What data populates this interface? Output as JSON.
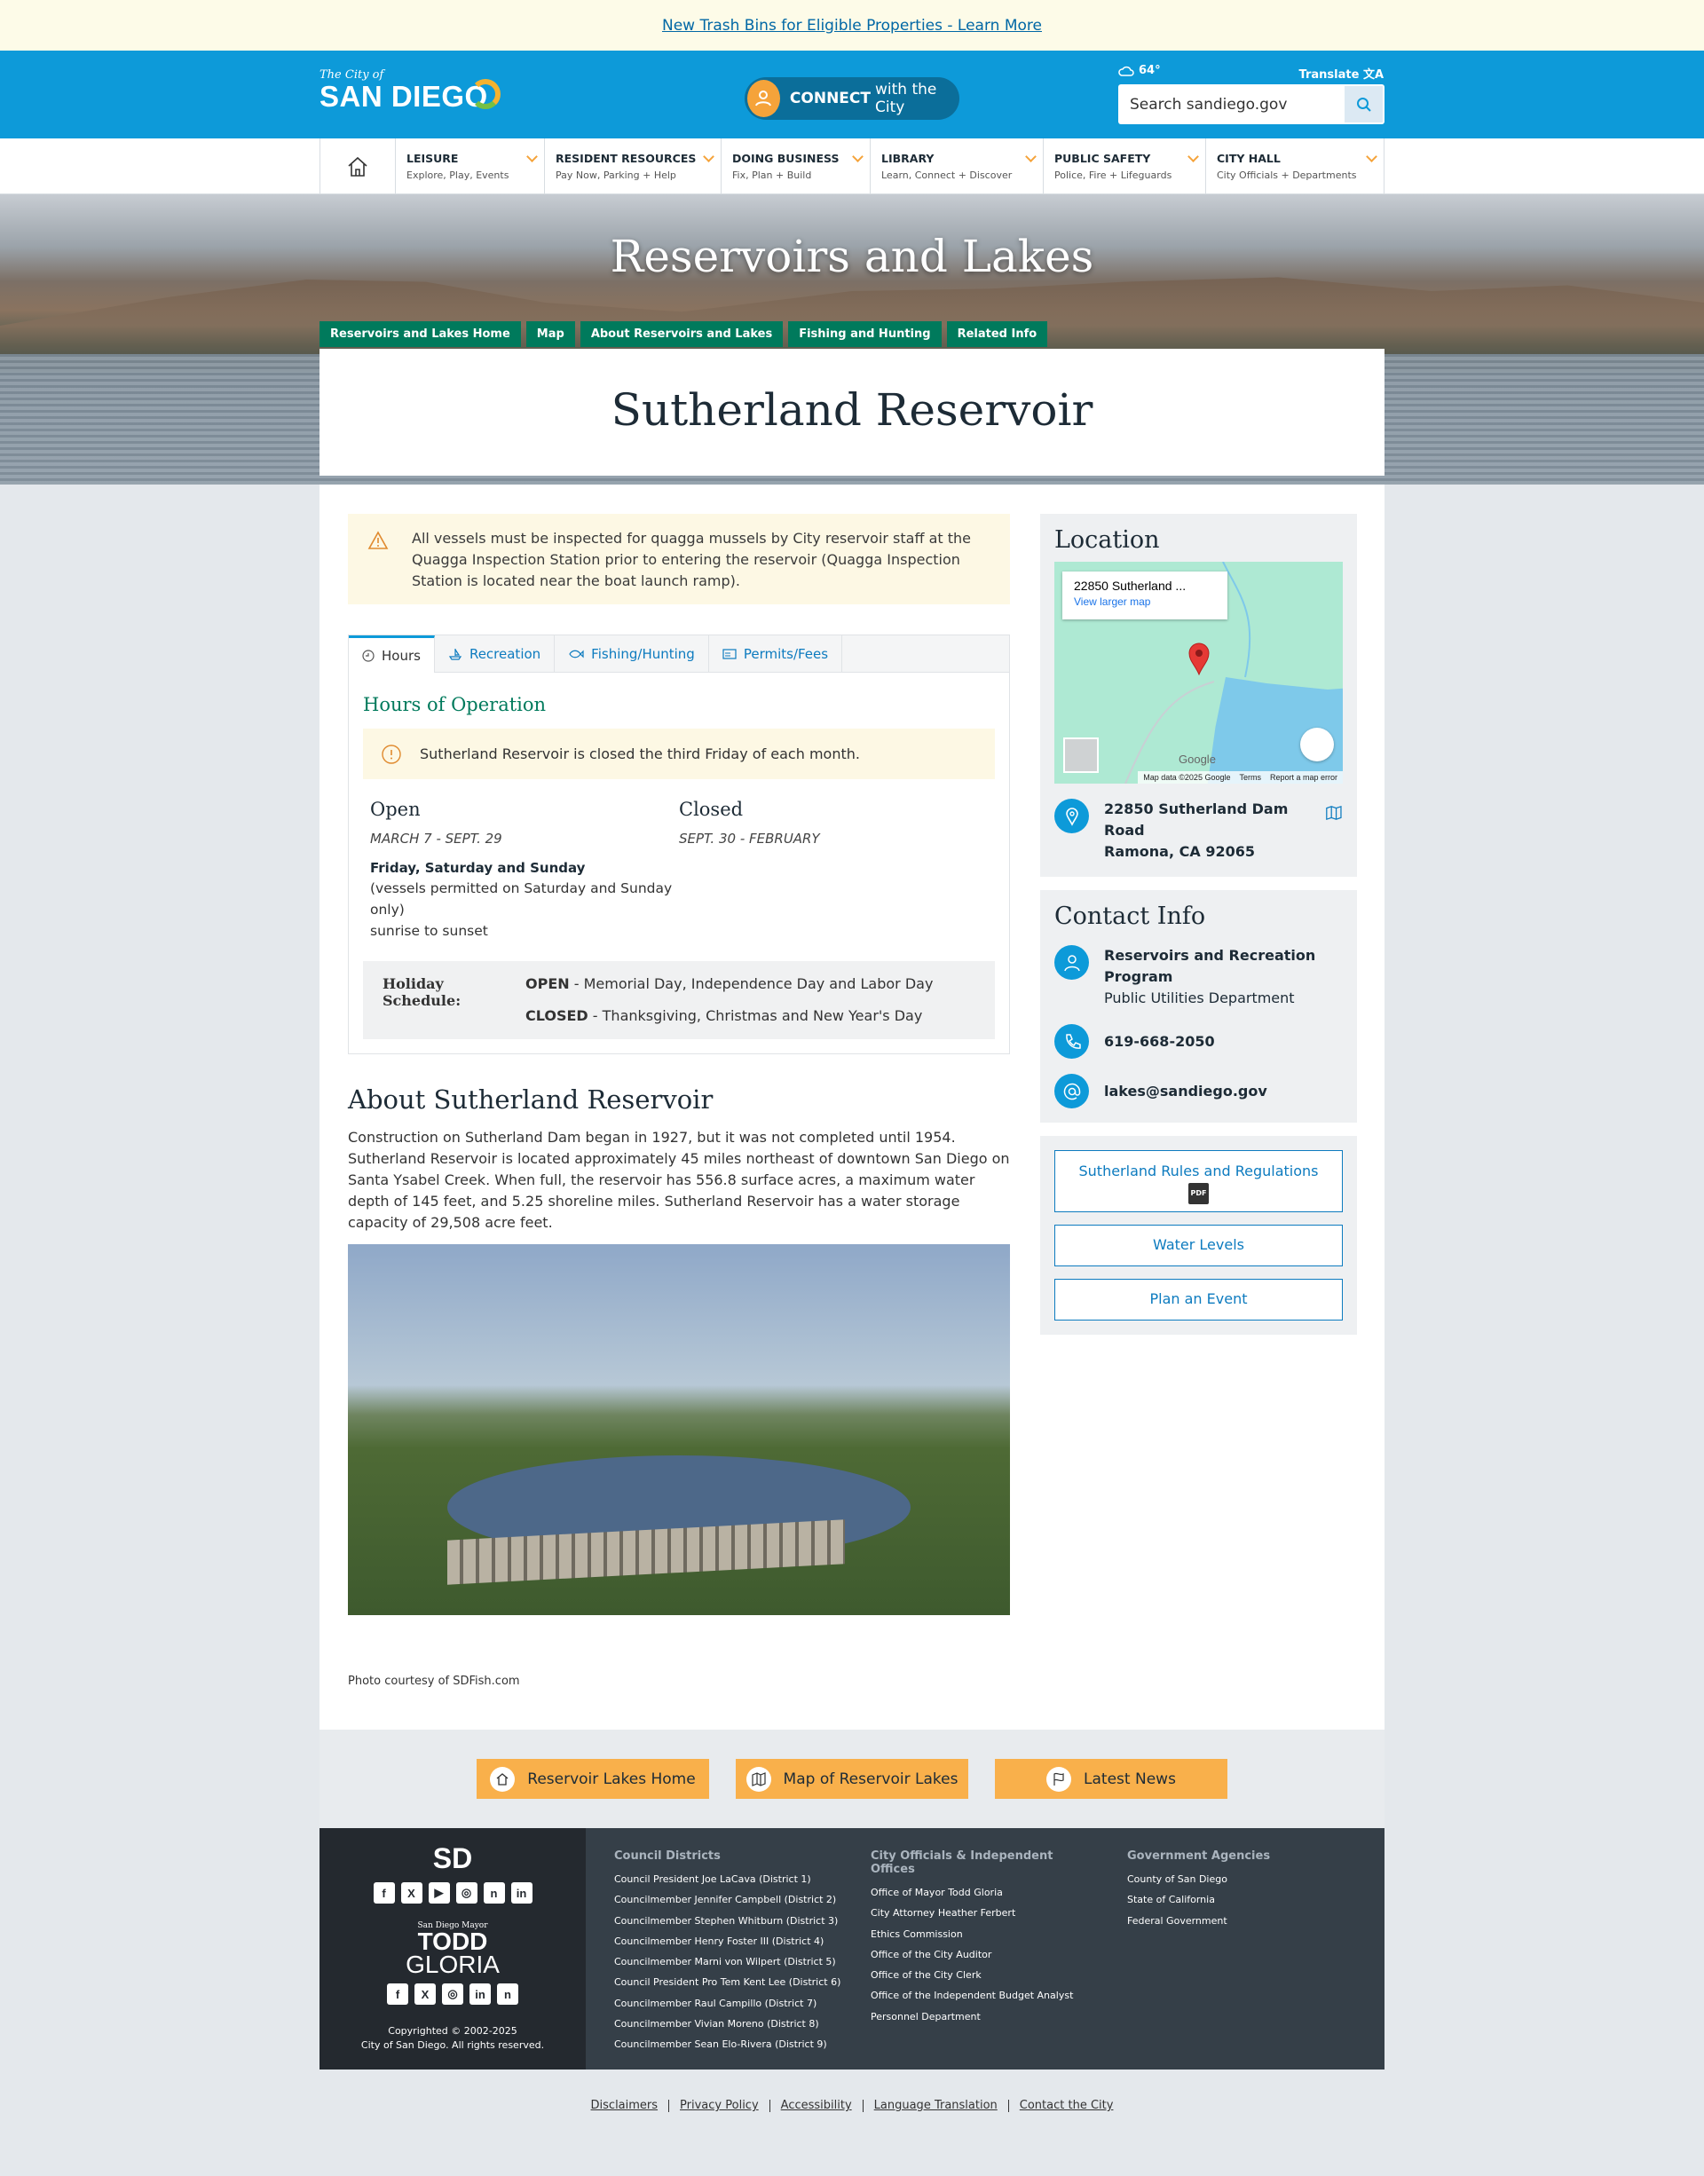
{
  "alert": {
    "text": "New Trash Bins for Eligible Properties - Learn More"
  },
  "header": {
    "logo_small": "The City of",
    "logo_big": "SAN DIEGO",
    "connect_bold": "CONNECT",
    "connect_rest": "with the City",
    "weather": "64°",
    "translate": "Translate",
    "search_placeholder": "Search sandiego.gov"
  },
  "nav": {
    "items": [
      {
        "title": "LEISURE",
        "sub": "Explore, Play, Events"
      },
      {
        "title": "RESIDENT RESOURCES",
        "sub": "Pay Now, Parking + Help"
      },
      {
        "title": "DOING BUSINESS",
        "sub": "Fix, Plan + Build"
      },
      {
        "title": "LIBRARY",
        "sub": "Learn, Connect + Discover"
      },
      {
        "title": "PUBLIC SAFETY",
        "sub": "Police, Fire + Lifeguards"
      },
      {
        "title": "CITY HALL",
        "sub": "City Officials + Departments"
      }
    ]
  },
  "hero": {
    "title": "Reservoirs and Lakes",
    "subnav": [
      "Reservoirs and Lakes Home",
      "Map",
      "About Reservoirs and Lakes",
      "Fishing and Hunting",
      "Related Info"
    ],
    "page_title": "Sutherland Reservoir"
  },
  "notice": "All vessels must be inspected for quagga mussels by City reservoir staff at the Quagga Inspection Station prior to entering the reservoir (Quagga Inspection Station is located near the boat launch ramp).",
  "tabs": [
    "Hours",
    "Recreation",
    "Fishing/Hunting",
    "Permits/Fees"
  ],
  "hours": {
    "heading": "Hours of Operation",
    "closed_note": "Sutherland Reservoir is closed the third Friday of each month.",
    "open_label": "Open",
    "open_range": "MARCH 7 - SEPT. 29",
    "open_days": "Friday, Saturday and Sunday",
    "open_detail1": "(vessels permitted on Saturday and Sunday only)",
    "open_detail2": "sunrise to sunset",
    "closed_label": "Closed",
    "closed_range": "SEPT. 30 - FEBRUARY",
    "holiday_label": "Holiday Schedule:",
    "holiday_open_label": "OPEN",
    "holiday_open_text": " - Memorial Day, Independence Day and Labor Day",
    "holiday_closed_label": "CLOSED",
    "holiday_closed_text": " - Thanksgiving, Christmas and New Year's Day"
  },
  "about": {
    "heading": "About Sutherland Reservoir",
    "text": "Construction on Sutherland Dam began in 1927, but it was not completed until 1954. Sutherland Reservoir is located approximately 45 miles northeast of downtown San Diego on Santa Ysabel Creek. When full, the reservoir has 556.8 surface acres, a maximum water depth of 145 feet, and 5.25 shoreline miles. Sutherland Reservoir has a water storage capacity of 29,508 acre feet.",
    "caption": "Photo courtesy of SDFish.com"
  },
  "location": {
    "heading": "Location",
    "map_title": "22850 Sutherland ...",
    "map_link": "View larger map",
    "map_data": "Map data ©2025 Google",
    "map_terms": "Terms",
    "map_report": "Report a map error",
    "google": "Google",
    "address1": "22850 Sutherland Dam Road",
    "address2": "Ramona, CA 92065"
  },
  "contact": {
    "heading": "Contact Info",
    "org": "Reservoirs and Recreation Program",
    "dept": "Public Utilities Department",
    "phone": "619-668-2050",
    "email": "lakes@sandiego.gov"
  },
  "link_buttons": {
    "rules": "Sutherland Rules and Regulations",
    "pdf": "PDF",
    "water": "Water Levels",
    "event": "Plan an Event"
  },
  "footer_buttons": [
    "Reservoir Lakes Home",
    "Map of Reservoir Lakes",
    "Latest News"
  ],
  "footer": {
    "sd": "SD",
    "mayor_small": "San Diego Mayor",
    "mayor_first": "TODD",
    "mayor_last": "GLORIA",
    "copyright1": "Copyrighted © 2002-2025",
    "copyright2": "City of San Diego. All rights reserved.",
    "col1_title": "Council Districts",
    "col1": [
      "Council President Joe LaCava (District 1)",
      "Councilmember Jennifer Campbell (District 2)",
      "Councilmember Stephen Whitburn (District 3)",
      "Councilmember Henry Foster III (District 4)",
      "Councilmember Marni von Wilpert (District 5)",
      "Council President Pro Tem Kent Lee (District 6)",
      "Councilmember Raul Campillo (District 7)",
      "Councilmember Vivian Moreno (District 8)",
      "Councilmember Sean Elo-Rivera (District 9)"
    ],
    "col2_title": "City Officials & Independent Offices",
    "col2": [
      "Office of Mayor Todd Gloria",
      "City Attorney Heather Ferbert",
      "Ethics Commission",
      "Office of the City Auditor",
      "Office of the City Clerk",
      "Office of the Independent Budget Analyst",
      "Personnel Department"
    ],
    "col3_title": "Government Agencies",
    "col3": [
      "County of San Diego",
      "State of California",
      "Federal Government"
    ]
  },
  "bottom_links": [
    "Disclaimers",
    "Privacy Policy",
    "Accessibility",
    "Language Translation",
    "Contact the City"
  ],
  "colors": {
    "brand_blue": "#0d9ad9",
    "accent_green": "#007a5c",
    "accent_orange": "#f9b04b",
    "footer_dark": "#353f48"
  }
}
